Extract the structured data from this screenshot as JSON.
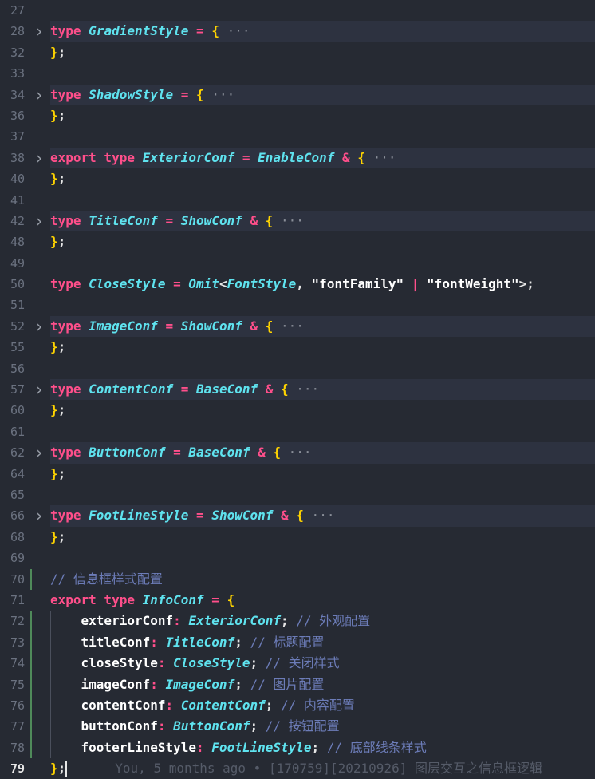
{
  "editor": {
    "language": "typescript",
    "folded_lines": [
      28,
      34,
      38,
      42,
      52,
      57,
      62,
      66
    ],
    "current_line": 79,
    "lines": [
      {
        "num": "27",
        "tokens": []
      },
      {
        "num": "28",
        "tokens": [
          [
            "kw",
            "type "
          ],
          [
            "ty",
            "GradientStyle"
          ],
          [
            "op",
            " = "
          ],
          [
            "br",
            "{"
          ],
          [
            "ell",
            " ···"
          ]
        ]
      },
      {
        "num": "32",
        "tokens": [
          [
            "br",
            "}"
          ],
          [
            "punct",
            ";"
          ]
        ]
      },
      {
        "num": "33",
        "tokens": []
      },
      {
        "num": "34",
        "tokens": [
          [
            "kw",
            "type "
          ],
          [
            "ty",
            "ShadowStyle"
          ],
          [
            "op",
            " = "
          ],
          [
            "br",
            "{"
          ],
          [
            "ell",
            " ···"
          ]
        ]
      },
      {
        "num": "36",
        "tokens": [
          [
            "br",
            "}"
          ],
          [
            "punct",
            ";"
          ]
        ]
      },
      {
        "num": "37",
        "tokens": []
      },
      {
        "num": "38",
        "tokens": [
          [
            "kw",
            "export type "
          ],
          [
            "ty",
            "ExteriorConf"
          ],
          [
            "op",
            " = "
          ],
          [
            "ty",
            "EnableConf"
          ],
          [
            "op",
            " & "
          ],
          [
            "br",
            "{"
          ],
          [
            "ell",
            " ···"
          ]
        ]
      },
      {
        "num": "40",
        "tokens": [
          [
            "br",
            "}"
          ],
          [
            "punct",
            ";"
          ]
        ]
      },
      {
        "num": "41",
        "tokens": []
      },
      {
        "num": "42",
        "tokens": [
          [
            "kw",
            "type "
          ],
          [
            "ty",
            "TitleConf"
          ],
          [
            "op",
            " = "
          ],
          [
            "ty",
            "ShowConf"
          ],
          [
            "op",
            " & "
          ],
          [
            "br",
            "{"
          ],
          [
            "ell",
            " ···"
          ]
        ]
      },
      {
        "num": "48",
        "tokens": [
          [
            "br",
            "}"
          ],
          [
            "punct",
            ";"
          ]
        ]
      },
      {
        "num": "49",
        "tokens": []
      },
      {
        "num": "50",
        "tokens": [
          [
            "kw",
            "type "
          ],
          [
            "ty",
            "CloseStyle"
          ],
          [
            "op",
            " = "
          ],
          [
            "ty",
            "Omit"
          ],
          [
            "punct",
            "<"
          ],
          [
            "ty",
            "FontStyle"
          ],
          [
            "punct",
            ", "
          ],
          [
            "str",
            "\"fontFamily\""
          ],
          [
            "op",
            " | "
          ],
          [
            "str",
            "\"fontWeight\""
          ],
          [
            "punct",
            ">;"
          ]
        ]
      },
      {
        "num": "51",
        "tokens": []
      },
      {
        "num": "52",
        "tokens": [
          [
            "kw",
            "type "
          ],
          [
            "ty",
            "ImageConf"
          ],
          [
            "op",
            " = "
          ],
          [
            "ty",
            "ShowConf"
          ],
          [
            "op",
            " & "
          ],
          [
            "br",
            "{"
          ],
          [
            "ell",
            " ···"
          ]
        ]
      },
      {
        "num": "55",
        "tokens": [
          [
            "br",
            "}"
          ],
          [
            "punct",
            ";"
          ]
        ]
      },
      {
        "num": "56",
        "tokens": []
      },
      {
        "num": "57",
        "tokens": [
          [
            "kw",
            "type "
          ],
          [
            "ty",
            "ContentConf"
          ],
          [
            "op",
            " = "
          ],
          [
            "ty",
            "BaseConf"
          ],
          [
            "op",
            " & "
          ],
          [
            "br",
            "{"
          ],
          [
            "ell",
            " ···"
          ]
        ]
      },
      {
        "num": "60",
        "tokens": [
          [
            "br",
            "}"
          ],
          [
            "punct",
            ";"
          ]
        ]
      },
      {
        "num": "61",
        "tokens": []
      },
      {
        "num": "62",
        "tokens": [
          [
            "kw",
            "type "
          ],
          [
            "ty",
            "ButtonConf"
          ],
          [
            "op",
            " = "
          ],
          [
            "ty",
            "BaseConf"
          ],
          [
            "op",
            " & "
          ],
          [
            "br",
            "{"
          ],
          [
            "ell",
            " ···"
          ]
        ]
      },
      {
        "num": "64",
        "tokens": [
          [
            "br",
            "}"
          ],
          [
            "punct",
            ";"
          ]
        ]
      },
      {
        "num": "65",
        "tokens": []
      },
      {
        "num": "66",
        "tokens": [
          [
            "kw",
            "type "
          ],
          [
            "ty",
            "FootLineStyle"
          ],
          [
            "op",
            " = "
          ],
          [
            "ty",
            "ShowConf"
          ],
          [
            "op",
            " & "
          ],
          [
            "br",
            "{"
          ],
          [
            "ell",
            " ···"
          ]
        ]
      },
      {
        "num": "68",
        "tokens": [
          [
            "br",
            "}"
          ],
          [
            "punct",
            ";"
          ]
        ]
      },
      {
        "num": "69",
        "tokens": []
      },
      {
        "num": "70",
        "tokens": [
          [
            "cm",
            "// 信息框样式配置"
          ]
        ]
      },
      {
        "num": "71",
        "tokens": [
          [
            "kw",
            "export type "
          ],
          [
            "ty",
            "InfoConf"
          ],
          [
            "op",
            " = "
          ],
          [
            "br",
            "{"
          ]
        ]
      },
      {
        "num": "72",
        "tokens": [
          [
            "prop",
            "    exteriorConf"
          ],
          [
            "op",
            ": "
          ],
          [
            "ty",
            "ExteriorConf"
          ],
          [
            "punct",
            "; "
          ],
          [
            "cm",
            "// 外观配置"
          ]
        ]
      },
      {
        "num": "73",
        "tokens": [
          [
            "prop",
            "    titleConf"
          ],
          [
            "op",
            ": "
          ],
          [
            "ty",
            "TitleConf"
          ],
          [
            "punct",
            "; "
          ],
          [
            "cm",
            "// 标题配置"
          ]
        ]
      },
      {
        "num": "74",
        "tokens": [
          [
            "prop",
            "    closeStyle"
          ],
          [
            "op",
            ": "
          ],
          [
            "ty",
            "CloseStyle"
          ],
          [
            "punct",
            "; "
          ],
          [
            "cm",
            "// 关闭样式"
          ]
        ]
      },
      {
        "num": "75",
        "tokens": [
          [
            "prop",
            "    imageConf"
          ],
          [
            "op",
            ": "
          ],
          [
            "ty",
            "ImageConf"
          ],
          [
            "punct",
            "; "
          ],
          [
            "cm",
            "// 图片配置"
          ]
        ]
      },
      {
        "num": "76",
        "tokens": [
          [
            "prop",
            "    contentConf"
          ],
          [
            "op",
            ": "
          ],
          [
            "ty",
            "ContentConf"
          ],
          [
            "punct",
            "; "
          ],
          [
            "cm",
            "// 内容配置"
          ]
        ]
      },
      {
        "num": "77",
        "tokens": [
          [
            "prop",
            "    buttonConf"
          ],
          [
            "op",
            ": "
          ],
          [
            "ty",
            "ButtonConf"
          ],
          [
            "punct",
            "; "
          ],
          [
            "cm",
            "// 按钮配置"
          ]
        ]
      },
      {
        "num": "78",
        "tokens": [
          [
            "prop",
            "    footerLineStyle"
          ],
          [
            "op",
            ": "
          ],
          [
            "ty",
            "FootLineStyle"
          ],
          [
            "punct",
            "; "
          ],
          [
            "cm",
            "// 底部线条样式"
          ]
        ]
      },
      {
        "num": "79",
        "tokens": [
          [
            "br",
            "}"
          ],
          [
            "punct",
            ";"
          ]
        ]
      }
    ],
    "blame": "You, 5 months ago • [170759][20210926] 图层交互之信息框逻辑"
  },
  "colors": {
    "background": "#262a33",
    "keyword": "#ff4f8b",
    "type": "#5fe3ef",
    "brace": "#ffd400",
    "comment": "#6c7cb8",
    "git_added_marker": "#4f8a5a"
  }
}
